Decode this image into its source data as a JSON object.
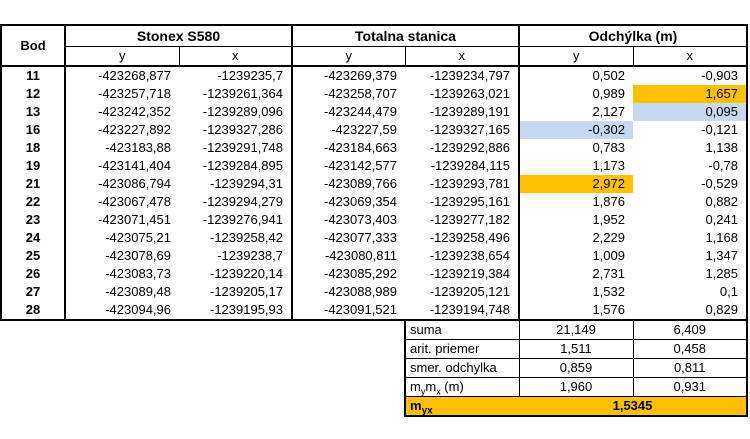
{
  "header": {
    "bod": "Bod",
    "group1": "Stonex S580",
    "group2": "Totalna stanica",
    "group3": "Odchýlka (m)",
    "y": "y",
    "x": "x"
  },
  "rows": [
    {
      "bod": "11",
      "s_y": "-423268,877",
      "s_x": "-1239235,7",
      "t_y": "-423269,379",
      "t_x": "-1239234,797",
      "d_y": "0,502",
      "d_x": "-0,903"
    },
    {
      "bod": "12",
      "s_y": "-423257,718",
      "s_x": "-1239261,364",
      "t_y": "-423258,707",
      "t_x": "-1239263,021",
      "d_y": "0,989",
      "d_x": "1,657"
    },
    {
      "bod": "13",
      "s_y": "-423242,352",
      "s_x": "-1239289,096",
      "t_y": "-423244,479",
      "t_x": "-1239289,191",
      "d_y": "2,127",
      "d_x": "0,095"
    },
    {
      "bod": "16",
      "s_y": "-423227,892",
      "s_x": "-1239327,286",
      "t_y": "-423227,59",
      "t_x": "-1239327,165",
      "d_y": "-0,302",
      "d_x": "-0,121"
    },
    {
      "bod": "18",
      "s_y": "-423183,88",
      "s_x": "-1239291,748",
      "t_y": "-423184,663",
      "t_x": "-1239292,886",
      "d_y": "0,783",
      "d_x": "1,138"
    },
    {
      "bod": "19",
      "s_y": "-423141,404",
      "s_x": "-1239284,895",
      "t_y": "-423142,577",
      "t_x": "-1239284,115",
      "d_y": "1,173",
      "d_x": "-0,78"
    },
    {
      "bod": "21",
      "s_y": "-423086,794",
      "s_x": "-1239294,31",
      "t_y": "-423089,766",
      "t_x": "-1239293,781",
      "d_y": "2,972",
      "d_x": "-0,529"
    },
    {
      "bod": "22",
      "s_y": "-423067,478",
      "s_x": "-1239294,279",
      "t_y": "-423069,354",
      "t_x": "-1239295,161",
      "d_y": "1,876",
      "d_x": "0,882"
    },
    {
      "bod": "23",
      "s_y": "-423071,451",
      "s_x": "-1239276,941",
      "t_y": "-423073,403",
      "t_x": "-1239277,182",
      "d_y": "1,952",
      "d_x": "0,241"
    },
    {
      "bod": "24",
      "s_y": "-423075,21",
      "s_x": "-1239258,42",
      "t_y": "-423077,333",
      "t_x": "-1239258,496",
      "d_y": "2,229",
      "d_x": "1,168"
    },
    {
      "bod": "25",
      "s_y": "-423078,69",
      "s_x": "-1239238,7",
      "t_y": "-423080,811",
      "t_x": "-1239238,654",
      "d_y": "1,009",
      "d_x": "1,347"
    },
    {
      "bod": "26",
      "s_y": "-423083,73",
      "s_x": "-1239220,14",
      "t_y": "-423085,292",
      "t_x": "-1239219,384",
      "d_y": "2,731",
      "d_x": "1,285"
    },
    {
      "bod": "27",
      "s_y": "-423089,48",
      "s_x": "-1239205,17",
      "t_y": "-423088,989",
      "t_x": "-1239205,121",
      "d_y": "1,532",
      "d_x": "0,1"
    },
    {
      "bod": "28",
      "s_y": "-423094,96",
      "s_x": "-1239195,93",
      "t_y": "-423091,521",
      "t_x": "-1239194,748",
      "d_y": "1,576",
      "d_x": "0,829"
    }
  ],
  "highlights": {
    "orange": "#ffc000",
    "blue": "#c5d9f1"
  },
  "summary": {
    "suma": {
      "label": "suma",
      "y": "21,149",
      "x": "6,409"
    },
    "priemer": {
      "label": "arit. priemer",
      "y": "1,511",
      "x": "0,458"
    },
    "odchylka": {
      "label": "smer. odchylka",
      "y": "0,859",
      "x": "0,811"
    },
    "mymx": {
      "m1": "m",
      "s1": "y",
      "m2": "m",
      "s2": "x",
      "unit": " (m)",
      "y": "1,960",
      "x": "0,931"
    },
    "myx": {
      "m": "m",
      "s": "yx",
      "value": "1,5345"
    }
  }
}
